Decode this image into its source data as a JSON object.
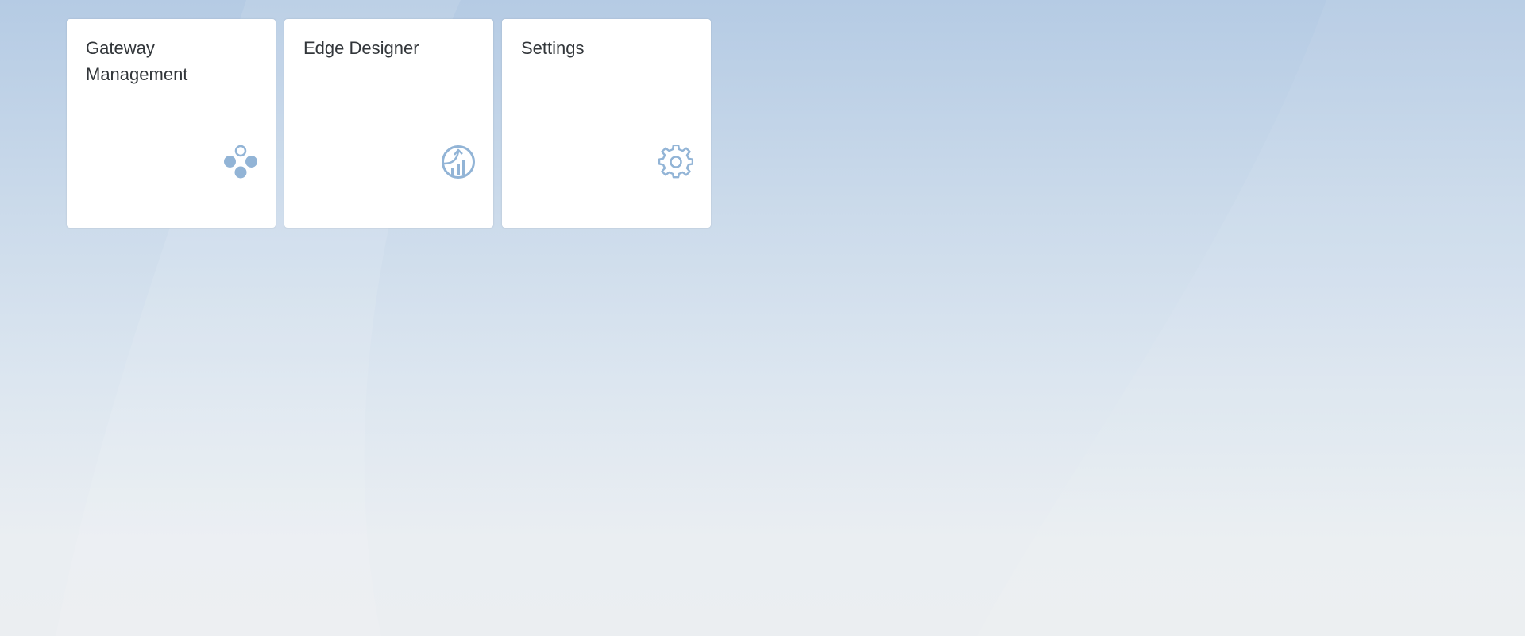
{
  "background": {
    "color_top": "#b5cbe4",
    "color_bottom": "#ebeef1"
  },
  "tiles": [
    {
      "title": "Gateway Management",
      "icon": "network-nodes-icon",
      "icon_color": "#92b4d6"
    },
    {
      "title": "Edge Designer",
      "icon": "chart-growth-icon",
      "icon_color": "#92b4d6"
    },
    {
      "title": "Settings",
      "icon": "gear-icon",
      "icon_color": "#92b4d6"
    }
  ]
}
